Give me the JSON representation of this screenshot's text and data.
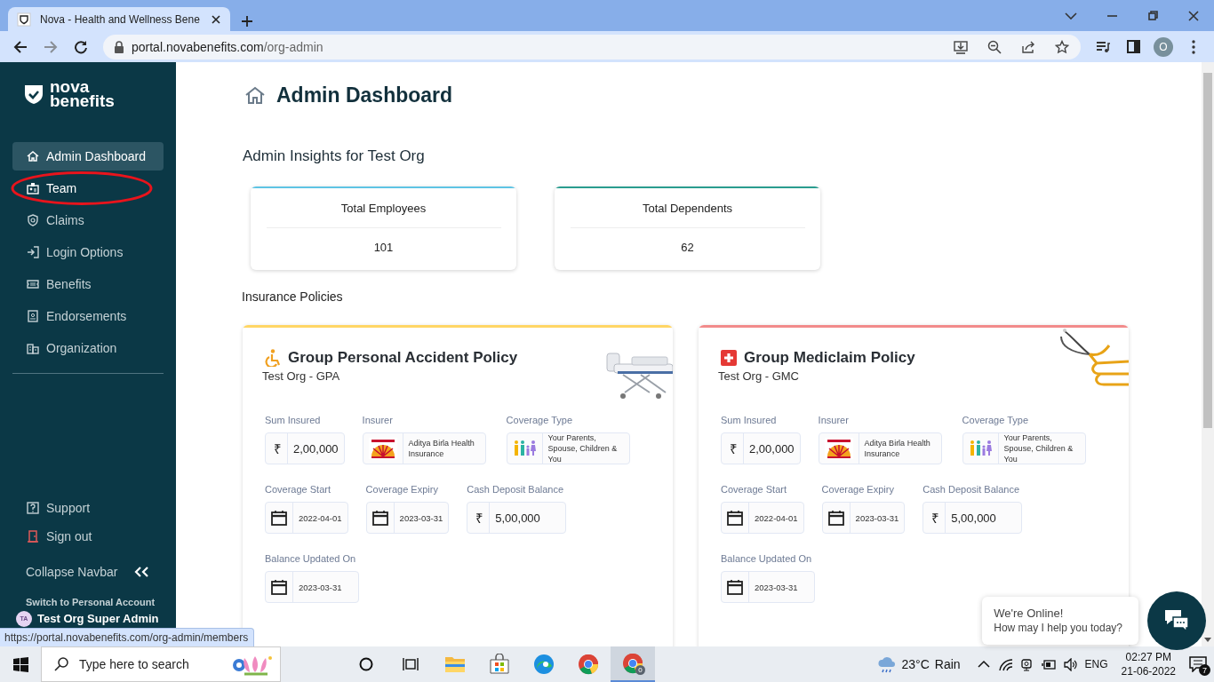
{
  "browser": {
    "tab_title": "Nova - Health and Wellness Bene",
    "url_host": "portal.novabenefits.com",
    "url_path": "/org-admin",
    "profile_initial": "O",
    "status_url": "https://portal.novabenefits.com/org-admin/members"
  },
  "sidebar": {
    "logo_line1": "nova",
    "logo_line2": "benefits",
    "items": [
      {
        "label": "Admin Dashboard",
        "selected": true,
        "hovered": false,
        "highlighted": false
      },
      {
        "label": "Team",
        "selected": false,
        "hovered": true,
        "highlighted": true
      },
      {
        "label": "Claims",
        "selected": false,
        "hovered": false,
        "highlighted": false
      },
      {
        "label": "Login Options",
        "selected": false,
        "hovered": false,
        "highlighted": false
      },
      {
        "label": "Benefits",
        "selected": false,
        "hovered": false,
        "highlighted": false
      },
      {
        "label": "Endorsements",
        "selected": false,
        "hovered": false,
        "highlighted": false
      },
      {
        "label": "Organization",
        "selected": false,
        "hovered": false,
        "highlighted": false
      }
    ],
    "footer_items": [
      {
        "label": "Support"
      },
      {
        "label": "Sign out"
      }
    ],
    "collapse_label": "Collapse Navbar",
    "switch_label": "Switch to Personal Account",
    "account_initials": "TA",
    "account_name": "Test Org Super Admin"
  },
  "page": {
    "title": "Admin Dashboard",
    "insights_heading": "Admin Insights for Test Org",
    "stats": [
      {
        "label": "Total Employees",
        "value": "101",
        "color": "#5ec4e4"
      },
      {
        "label": "Total Dependents",
        "value": "62",
        "color": "#2a9d8f"
      }
    ],
    "policies_heading": "Insurance Policies",
    "policies": [
      {
        "kind": "accident",
        "title": "Group Personal Accident Policy",
        "subtitle": "Test Org - GPA",
        "color": "#ffd665",
        "rows": [
          [
            {
              "kind": "amount",
              "label": "Sum Insured",
              "currency": "₹",
              "value": "2,00,000"
            },
            {
              "kind": "insurer",
              "label": "Insurer",
              "value": "Aditya Birla Health Insurance"
            },
            {
              "kind": "coverage",
              "label": "Coverage Type",
              "value": "Your Parents, Spouse, Children & You"
            }
          ],
          [
            {
              "kind": "date",
              "label": "Coverage Start",
              "value": "2022-04-01"
            },
            {
              "kind": "date",
              "label": "Coverage Expiry",
              "value": "2023-03-31"
            },
            {
              "kind": "amount",
              "label": "Cash Deposit Balance",
              "currency": "₹",
              "value": "5,00,000"
            }
          ],
          [
            {
              "kind": "date",
              "label": "Balance Updated On",
              "value": "2023-03-31"
            }
          ]
        ]
      },
      {
        "kind": "mediclaim",
        "title": "Group Mediclaim Policy",
        "subtitle": "Test Org - GMC",
        "color": "#f28b8b",
        "rows": [
          [
            {
              "kind": "amount",
              "label": "Sum Insured",
              "currency": "₹",
              "value": "2,00,000"
            },
            {
              "kind": "insurer",
              "label": "Insurer",
              "value": "Aditya Birla Health Insurance"
            },
            {
              "kind": "coverage",
              "label": "Coverage Type",
              "value": "Your Parents, Spouse, Children & You"
            }
          ],
          [
            {
              "kind": "date",
              "label": "Coverage Start",
              "value": "2022-04-01"
            },
            {
              "kind": "date",
              "label": "Coverage Expiry",
              "value": "2023-03-31"
            },
            {
              "kind": "amount",
              "label": "Cash Deposit Balance",
              "currency": "₹",
              "value": "5,00,000"
            }
          ],
          [
            {
              "kind": "date",
              "label": "Balance Updated On",
              "value": "2023-03-31"
            }
          ]
        ]
      }
    ]
  },
  "chat": {
    "line1": "We're Online!",
    "line2": "How may I help you today?"
  },
  "taskbar": {
    "search_placeholder": "Type here to search",
    "chrome_badge": "0",
    "temperature": "23°C",
    "weather": "Rain",
    "language": "ENG",
    "time": "02:27 PM",
    "date": "21-06-2022",
    "notifications": "7"
  }
}
